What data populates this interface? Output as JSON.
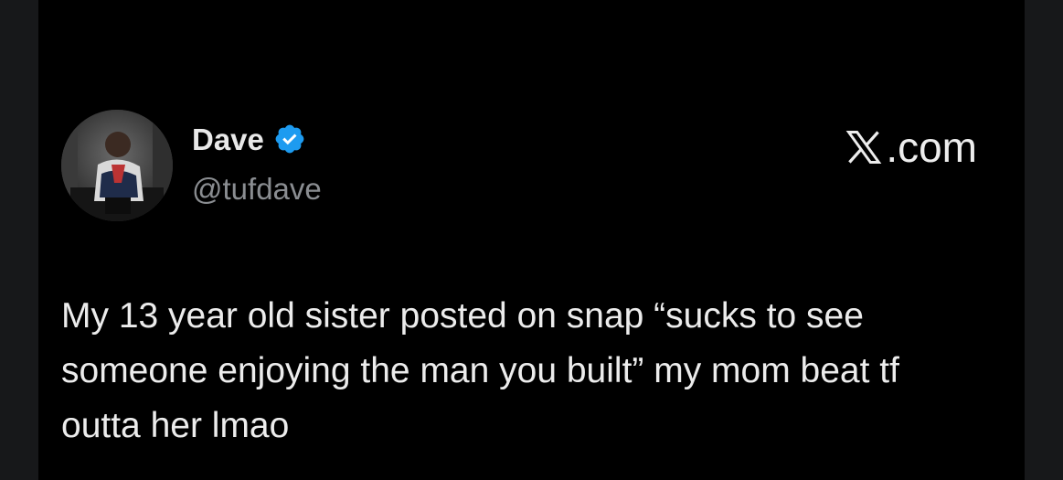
{
  "author": {
    "name": "Dave",
    "handle": "@tufdave",
    "verified_icon": "verified-badge-icon"
  },
  "site": {
    "logo_icon": "x-logo-icon",
    "domain_suffix": ".com"
  },
  "tweet": {
    "text": "My 13 year old sister posted on snap “sucks to see someone enjoying the man you built” my mom beat tf outta her lmao"
  },
  "colors": {
    "background": "#000000",
    "frame": "#17181a",
    "text": "#ececec",
    "handle": "#8a8d91",
    "verified": "#1d9bf0"
  }
}
